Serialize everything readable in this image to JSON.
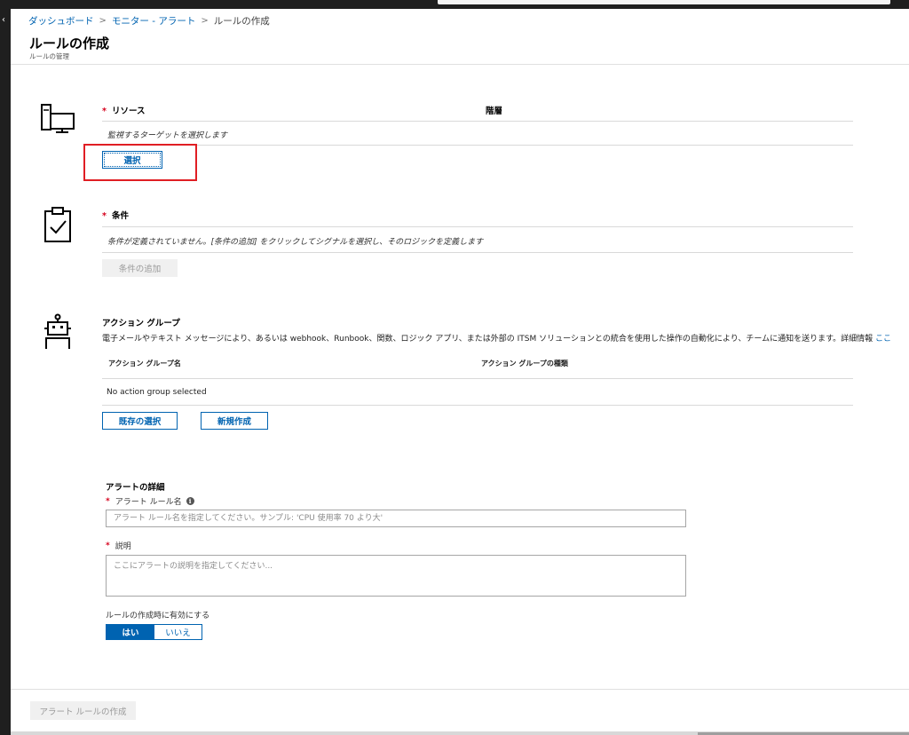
{
  "breadcrumb": {
    "items": [
      "ダッシュボード",
      "モニター - アラート"
    ],
    "current": "ルールの作成"
  },
  "page": {
    "title": "ルールの作成",
    "subtitle": "ルールの管理"
  },
  "resource": {
    "label": "リソース",
    "column_hierarchy": "階層",
    "hint": "監視するターゲットを選択します",
    "select_button": "選択"
  },
  "condition": {
    "label": "条件",
    "hint": "条件が定義されていません。[条件の追加] をクリックしてシグナルを選択し、そのロジックを定義します",
    "add_button": "条件の追加"
  },
  "action_group": {
    "label": "アクション グループ",
    "description": "電子メールやテキスト メッセージにより、あるいは webhook、Runbook、関数、ロジック アプリ、または外部の ITSM ソリューションとの統合を使用した操作の自動化により、チームに通知を送ります。詳細情報",
    "learn_more_link": "ここ",
    "col_name": "アクション グループ名",
    "col_type": "アクション グループの種類",
    "empty_text": "No action group selected",
    "select_existing_button": "既存の選択",
    "create_new_button": "新規作成"
  },
  "alert_details": {
    "heading": "アラートの詳細",
    "rule_name_label": "アラート ルール名",
    "rule_name_placeholder": "アラート ルール名を指定してください。サンプル: 'CPU 使用率 70 より大'",
    "description_label": "説明",
    "description_placeholder": "ここにアラートの説明を指定してください...",
    "enable_label": "ルールの作成時に有効にする",
    "toggle_yes": "はい",
    "toggle_no": "いいえ"
  },
  "footer": {
    "create_button": "アラート ルールの作成"
  },
  "required_mark": "*",
  "info_glyph": "i",
  "colors": {
    "accent": "#0063b1",
    "required": "#d6001c",
    "highlight": "#e01e24"
  }
}
